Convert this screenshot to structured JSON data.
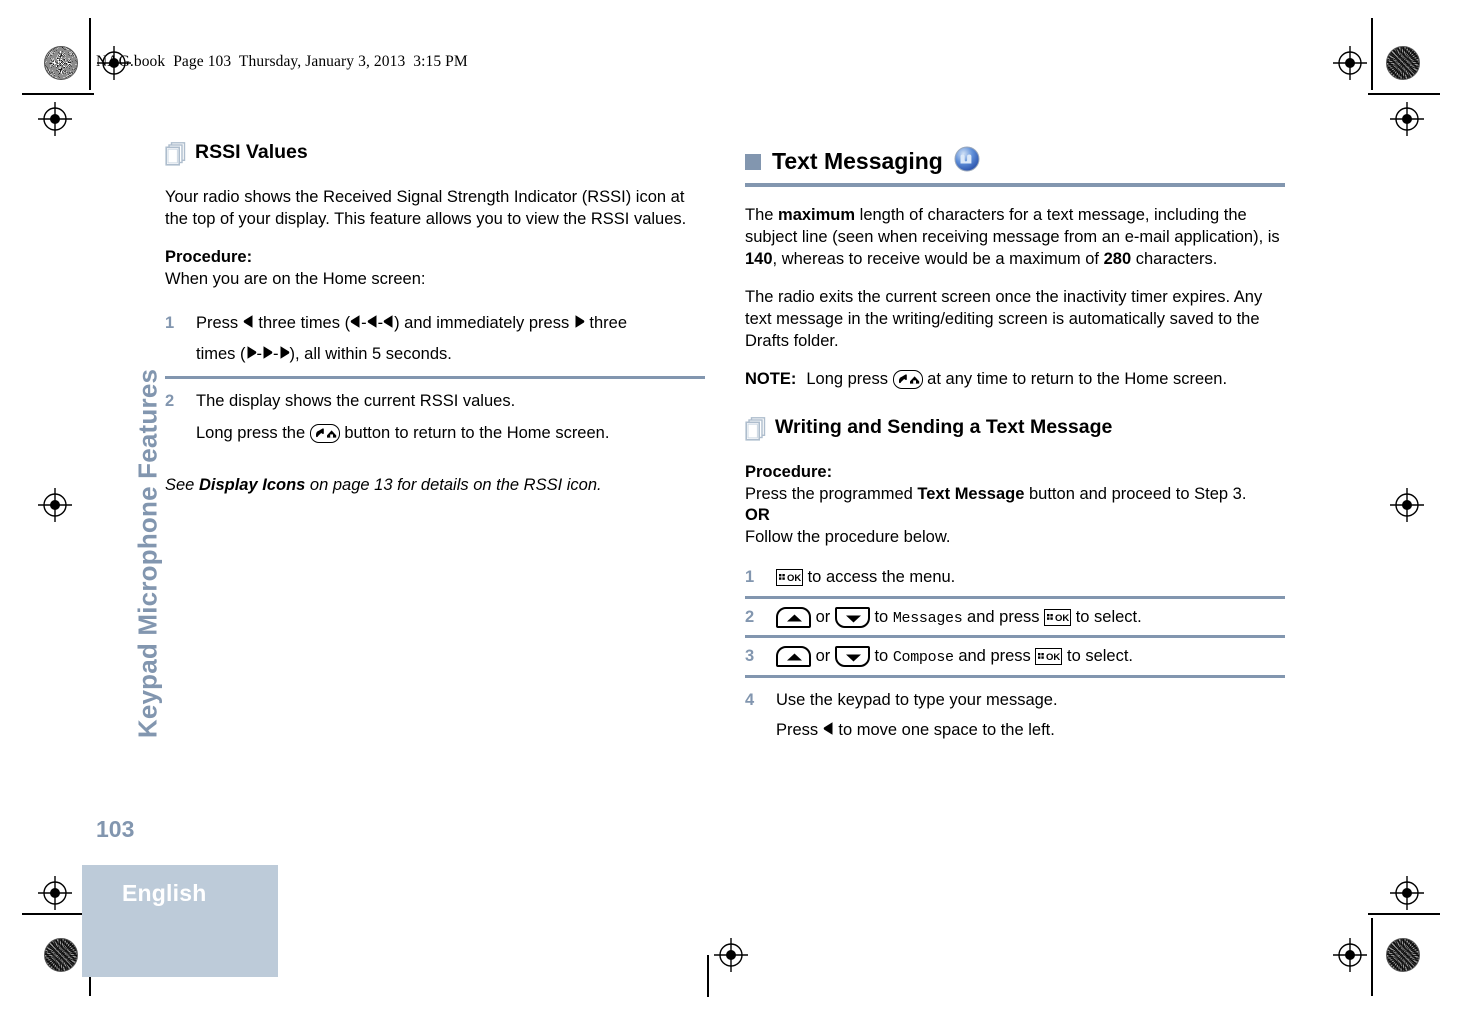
{
  "header": {
    "filename_line": "NAG.book  Page 103  Thursday, January 3, 2013  3:15 PM"
  },
  "sidebar": {
    "chapter_title": "Keypad Microphone Features",
    "page_number": "103",
    "language_tab": "English",
    "accent_color": "#8296af",
    "tab_background": "#bdcbd9"
  },
  "left_column": {
    "heading": "RSSI Values",
    "heading_icon": "pages-icon",
    "intro": "Your radio shows the Received Signal Strength Indicator (RSSI) icon at the top of your display. This feature allows you to view the RSSI values.",
    "procedure_label": "Procedure:",
    "procedure_intro": "When you are on the Home screen:",
    "steps": [
      {
        "number": "1",
        "line1_a": "Press",
        "line1_b": "three times (",
        "line1_c": ") and immediately press",
        "line1_d": "three",
        "line2_a": "times (",
        "line2_b": "), all within 5 seconds."
      },
      {
        "number": "2",
        "line1": "The display shows the current RSSI values.",
        "line2_a": "Long press the",
        "line2_b": "button to return to the Home screen."
      }
    ],
    "cross_reference": {
      "lead": "See ",
      "bold": "Display Icons",
      "tail": " on page 13 for details on the RSSI icon."
    }
  },
  "right_column": {
    "heading": "Text Messaging",
    "heading_bullet": "square-bullet",
    "heading_icon": "message-bubble-icon",
    "paragraph_1": {
      "a": "The ",
      "bold_1": "maximum",
      "b": " length of characters for a text message, including the subject line (seen when receiving message from an e-mail application), is ",
      "bold_2": "140",
      "c": ", whereas to receive would be a maximum of ",
      "bold_3": "280",
      "d": " characters."
    },
    "paragraph_2": "The radio exits the current screen once the inactivity timer expires. Any text message in the writing/editing screen is automatically saved to the Drafts folder.",
    "note": {
      "label": "NOTE:",
      "text_a": "Long press",
      "text_b": "at any time to return to the Home screen."
    },
    "subheading": "Writing and Sending a Text Message",
    "subheading_icon": "pages-icon",
    "procedure_label": "Procedure:",
    "procedure_lines": {
      "line1_a": "Press the programmed ",
      "line1_bold": "Text Message",
      "line1_b": " button and proceed to Step 3.",
      "or": "OR",
      "line2": "Follow the procedure below."
    },
    "steps": [
      {
        "number": "1",
        "a": "",
        "b": "to access the menu."
      },
      {
        "number": "2",
        "a": "or",
        "b": "to",
        "target": "Messages",
        "c": "and press",
        "d": "to select."
      },
      {
        "number": "3",
        "a": "or",
        "b": "to",
        "target": "Compose",
        "c": "and press",
        "d": "to select."
      },
      {
        "number": "4",
        "line1": "Use the keypad to type your message.",
        "line2_a": "Press",
        "line2_b": "to move one space to the left."
      }
    ]
  }
}
